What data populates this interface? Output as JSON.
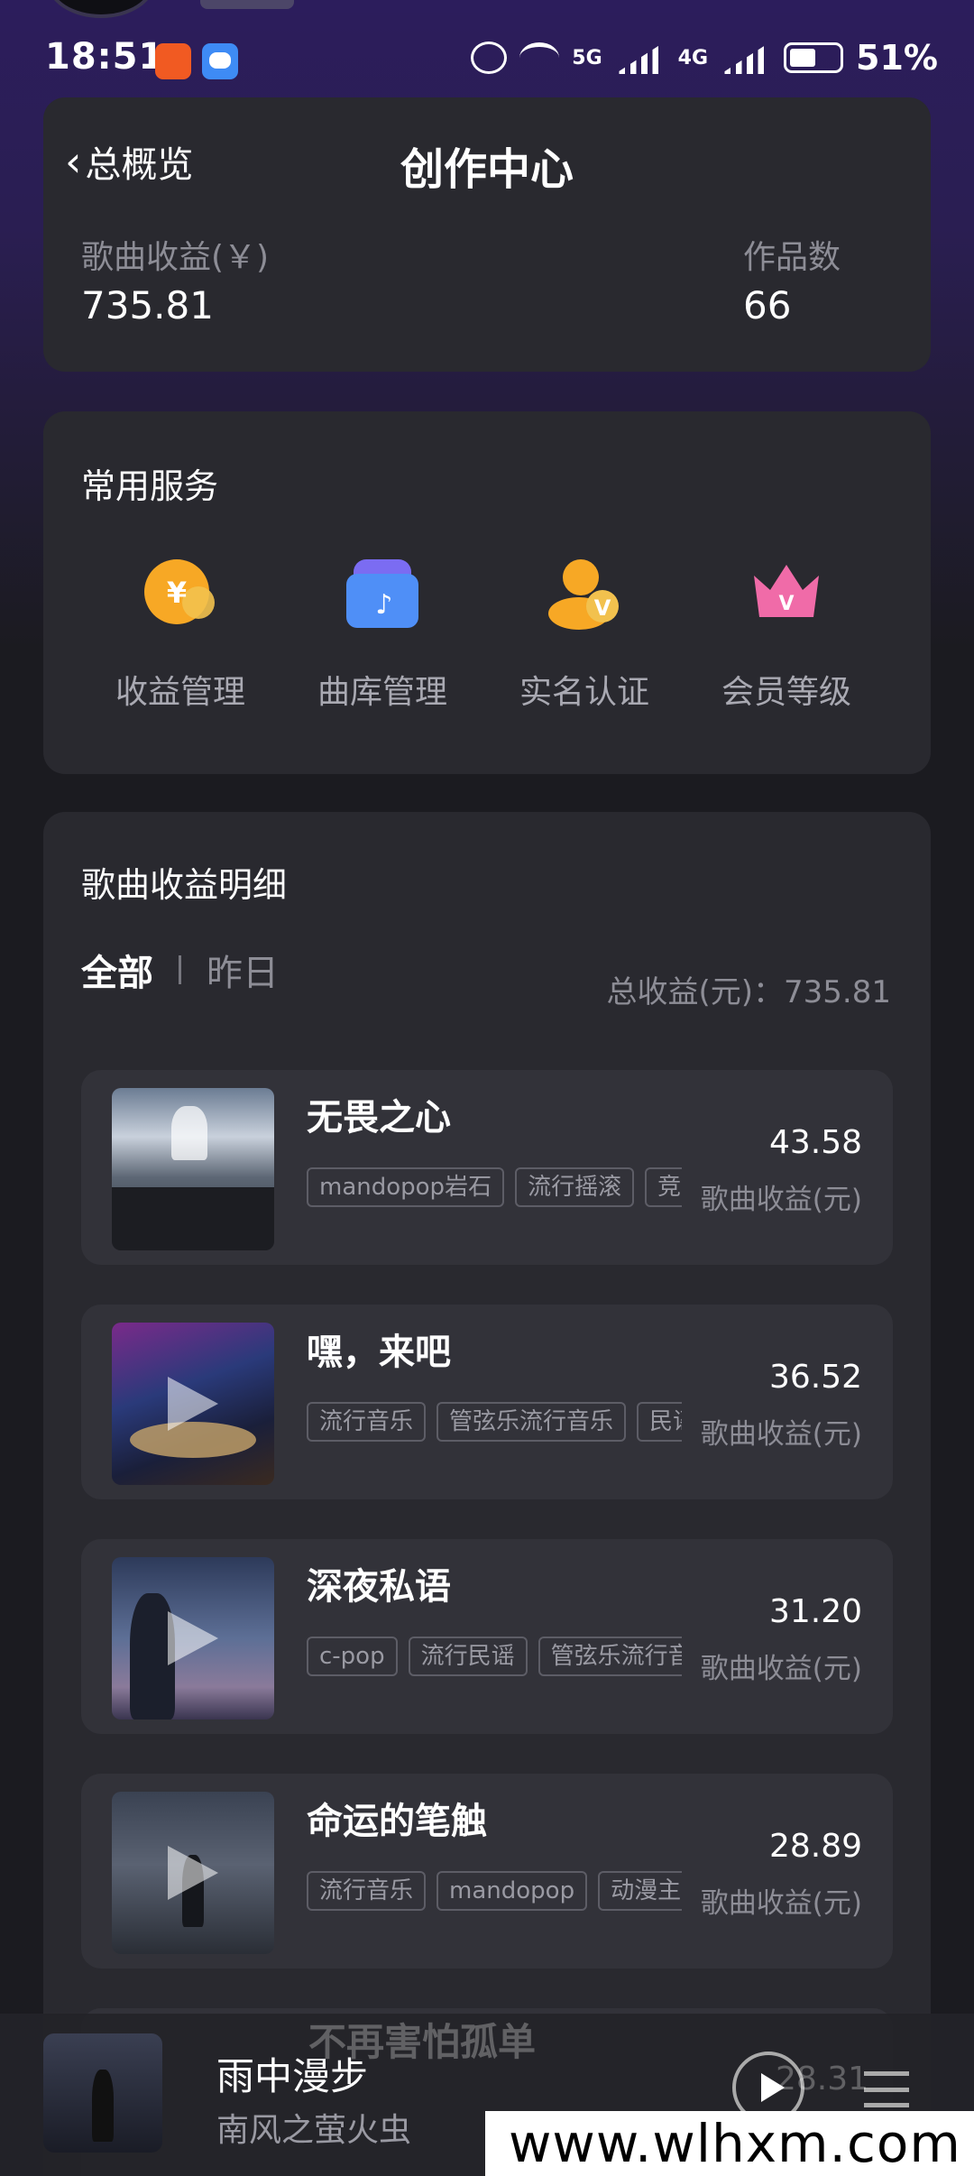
{
  "status_bar": {
    "time": "18:51",
    "battery": "51%",
    "net1": "5G",
    "net2": "4G"
  },
  "header": {
    "back_label": "总概览",
    "title": "创作中心",
    "earnings_label": "歌曲收益(￥)",
    "earnings_value": "735.81",
    "works_label": "作品数",
    "works_value": "66"
  },
  "services": {
    "title": "常用服务",
    "items": [
      {
        "label": "收益管理",
        "icon": "yen-coin-icon"
      },
      {
        "label": "曲库管理",
        "icon": "music-library-icon"
      },
      {
        "label": "实名认证",
        "icon": "verified-user-icon"
      },
      {
        "label": "会员等级",
        "icon": "crown-icon"
      }
    ]
  },
  "earnings": {
    "title": "歌曲收益明细",
    "tab_all": "全部",
    "tab_yesterday": "昨日",
    "total": "总收益(元)：735.81",
    "value_label": "歌曲收益(元)",
    "songs": [
      {
        "title": "无畏之心",
        "tags": [
          "mandopop岩石",
          "流行摇滚",
          "竞技"
        ],
        "value": "43.58"
      },
      {
        "title": "嘿，来吧",
        "tags": [
          "流行音乐",
          "管弦乐流行音乐",
          "民谣"
        ],
        "value": "36.52"
      },
      {
        "title": "深夜私语",
        "tags": [
          "c-pop",
          "流行民谣",
          "管弦乐流行音乐"
        ],
        "value": "31.20"
      },
      {
        "title": "命运的笔触",
        "tags": [
          "流行音乐",
          "mandopop",
          "动漫主题曲"
        ],
        "value": "28.89"
      }
    ],
    "peek_song_title": "不再害怕孤单",
    "peek_song_value": "28.31"
  },
  "player": {
    "title": "雨中漫步",
    "artist": "南风之萤火虫"
  },
  "watermark": "www.wlhxm.com"
}
